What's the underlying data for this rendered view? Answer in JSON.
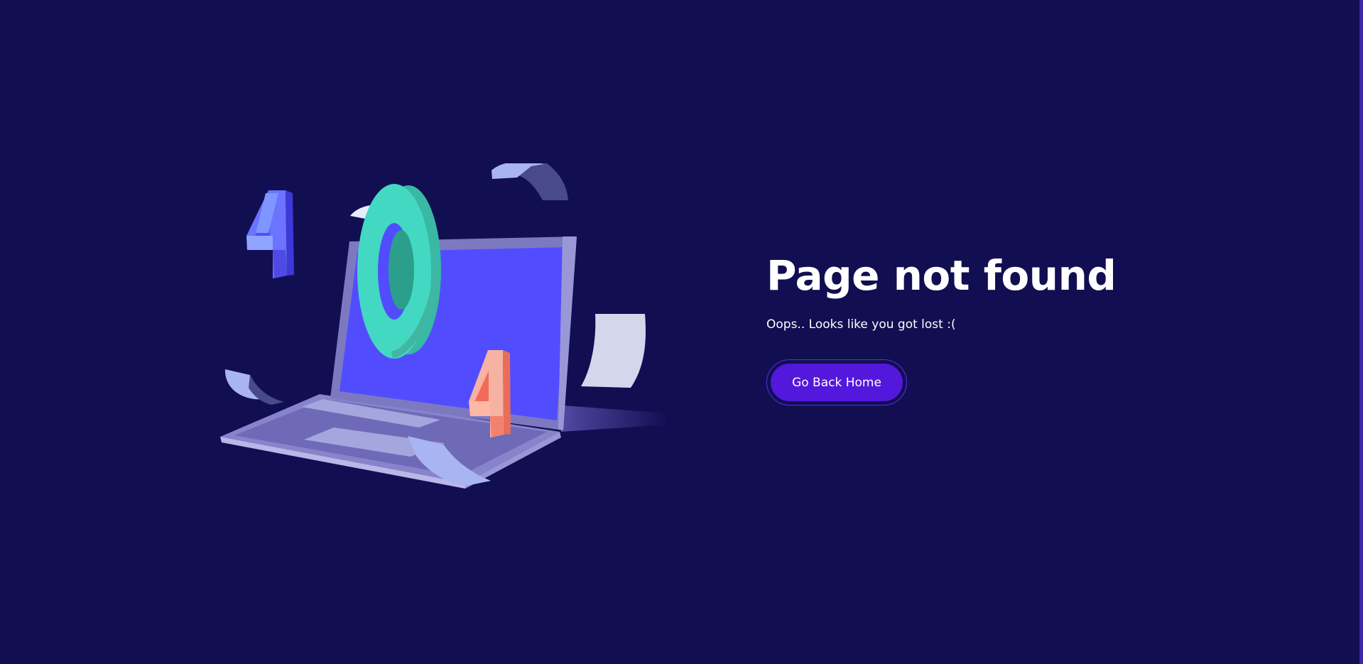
{
  "page": {
    "title": "Page not found",
    "subtitle": "Oops.. Looks like you got lost :(",
    "cta_label": "Go Back Home"
  },
  "illustration": {
    "glyphs": {
      "first": "4",
      "second": "0",
      "third": "4"
    },
    "colors": {
      "background": "#120e52",
      "screen": "#514dff",
      "laptop_body": "#7474c1",
      "teal": "#43d8c2",
      "coral": "#f26b58",
      "paper": "#a9b4f2",
      "blue_four": "#6b73ff"
    }
  },
  "colors": {
    "accent": "#5318db",
    "accent_ring": "#5a2ee6",
    "text": "#ffffff"
  }
}
